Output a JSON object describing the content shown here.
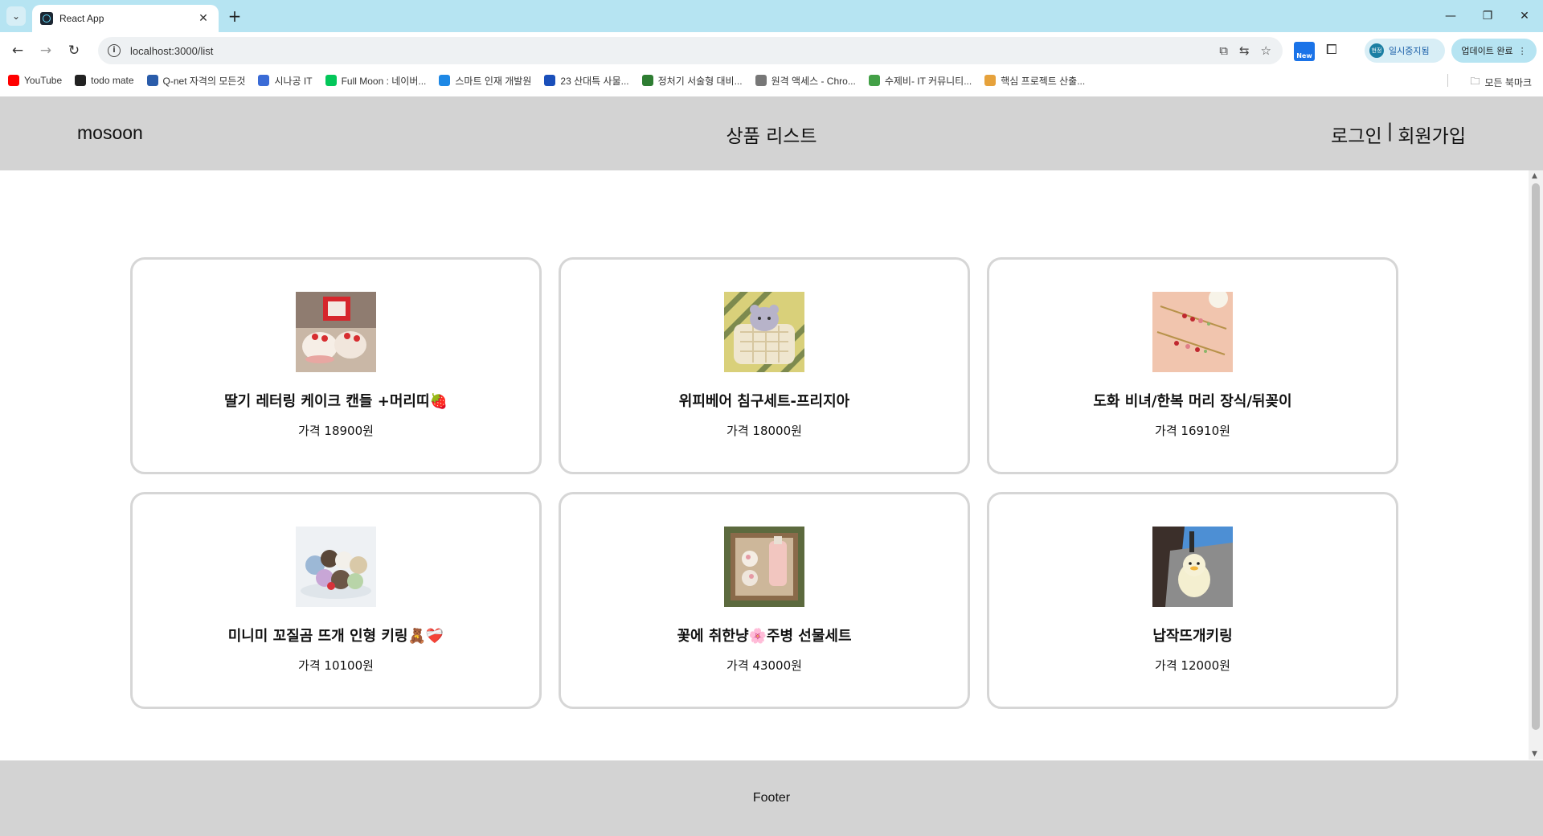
{
  "browser": {
    "tab_title": "React App",
    "url": "localhost:3000/list",
    "new_badge": "New",
    "profile_label": "일시중지됨",
    "profile_avatar_text": "현정",
    "update_label": "업데이트 완료",
    "bookmarks": [
      {
        "label": "YouTube",
        "color": "#ff0000"
      },
      {
        "label": "todo mate",
        "color": "#222222"
      },
      {
        "label": "Q-net 자격의 모든것",
        "color": "#2a5caa"
      },
      {
        "label": "시나공 IT",
        "color": "#3a6bd6"
      },
      {
        "label": "Full Moon : 네이버...",
        "color": "#03c75a"
      },
      {
        "label": "스마트 인재 개발원",
        "color": "#1e88e5"
      },
      {
        "label": "23 산대특 사물...",
        "color": "#1a4fba"
      },
      {
        "label": "정처기 서술형 대비...",
        "color": "#2e7d32"
      },
      {
        "label": "원격 액세스 - Chro...",
        "color": "#777777"
      },
      {
        "label": "수제비- IT 커뮤니티...",
        "color": "#43a047"
      },
      {
        "label": "핵심 프로젝트 산출...",
        "color": "#e6a23c"
      }
    ],
    "all_bookmarks": "모든 북마크"
  },
  "header": {
    "brand": "mosoon",
    "title": "상품 리스트",
    "login": "로그인",
    "separator": "|",
    "signup": "회원가입"
  },
  "products": [
    {
      "name": "딸기 레터링 케이크 캔들 +머리띠🍓",
      "price": "가격 18900원",
      "image": "strawberry-cake-candle"
    },
    {
      "name": "위피베어 침구세트-프리지아",
      "price": "가격 18000원",
      "image": "bear-bedding-set"
    },
    {
      "name": "도화 비녀/한복 머리 장식/뒤꽂이",
      "price": "가격 16910원",
      "image": "hair-pin"
    },
    {
      "name": "미니미 꼬질곰 뜨개 인형 키링🧸❤️‍🩹",
      "price": "가격 10100원",
      "image": "knitted-bear-keyring"
    },
    {
      "name": "꽃에 취한냥🌸주병 선물세트",
      "price": "가격 43000원",
      "image": "liquor-gift-set"
    },
    {
      "name": "납작뜨개키링",
      "price": "가격 12000원",
      "image": "flat-knit-keyring"
    }
  ],
  "footer": {
    "text": "Footer"
  }
}
